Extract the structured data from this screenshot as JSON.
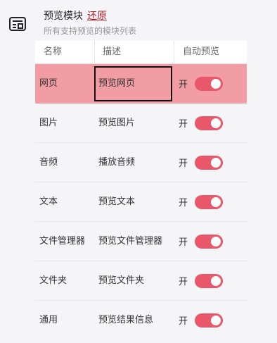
{
  "header": {
    "title": "预览模块",
    "restore_label": "还原",
    "subtitle": "所有支持预览的模块列表",
    "icon": "module-list-icon"
  },
  "table": {
    "columns": [
      "名称",
      "描述",
      "自动预览"
    ],
    "rows": [
      {
        "name": "网页",
        "desc": "预览网页",
        "toggle_label": "开",
        "enabled": true,
        "selected": true
      },
      {
        "name": "图片",
        "desc": "预览图片",
        "toggle_label": "开",
        "enabled": true,
        "selected": false
      },
      {
        "name": "音频",
        "desc": "播放音频",
        "toggle_label": "开",
        "enabled": true,
        "selected": false
      },
      {
        "name": "文本",
        "desc": "预览文本",
        "toggle_label": "开",
        "enabled": true,
        "selected": false
      },
      {
        "name": "文件管理器",
        "desc": "预览文件管理器",
        "toggle_label": "开",
        "enabled": true,
        "selected": false
      },
      {
        "name": "文件夹",
        "desc": "预览文件夹",
        "toggle_label": "开",
        "enabled": true,
        "selected": false
      },
      {
        "name": "通用",
        "desc": "预览结果信息",
        "toggle_label": "开",
        "enabled": true,
        "selected": false
      }
    ]
  },
  "colors": {
    "accent": "#e9576a",
    "selected_row": "#f29ca3",
    "restore_link": "#b8202a"
  }
}
